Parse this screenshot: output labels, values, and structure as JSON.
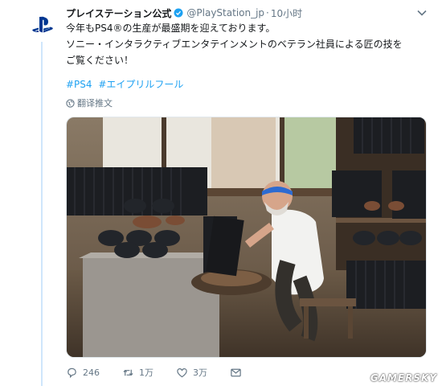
{
  "tweet": {
    "author_name": "プレイステーション公式",
    "handle": "@PlayStation_jp",
    "separator": "·",
    "time": "10小时",
    "lines": [
      "今年もPS4®の生産が最盛期を迎えております。",
      "ソニー・インタラクティブエンタテインメントのベテラン社員による匠の技を",
      "ご覧ください！"
    ],
    "hashtags": [
      "#PS4",
      "#エイプリルフール"
    ],
    "translate_label": "翻译推文"
  },
  "stats": {
    "replies": "246",
    "retweets": "1万",
    "likes": "3万"
  },
  "icons": {
    "avatar": "playstation-logo-icon",
    "verified": "verified-badge-icon",
    "menu": "chevron-down-icon",
    "translate": "globe-icon",
    "reply": "reply-icon",
    "retweet": "retweet-icon",
    "like": "heart-icon",
    "share": "message-icon"
  },
  "colors": {
    "link": "#1da1f2",
    "muted": "#657786",
    "thread_line": "#cfe6fb",
    "brand": "#003791"
  },
  "watermark": "GAMERSKY"
}
